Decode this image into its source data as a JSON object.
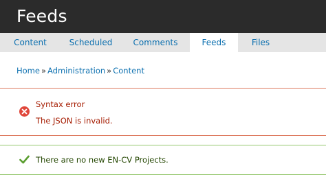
{
  "header": {
    "title": "Feeds"
  },
  "tabs": [
    {
      "label": "Content",
      "active": false
    },
    {
      "label": "Scheduled",
      "active": false
    },
    {
      "label": "Comments",
      "active": false
    },
    {
      "label": "Feeds",
      "active": true
    },
    {
      "label": "Files",
      "active": false
    }
  ],
  "breadcrumb": {
    "items": [
      "Home",
      "Administration",
      "Content"
    ],
    "separator": "»"
  },
  "messages": {
    "error": {
      "title": "Syntax error",
      "text": "The JSON is invalid.",
      "icon": "error-x-circle-icon",
      "color": "#a51b00",
      "border_color": "#dd7a5f"
    },
    "status": {
      "text": "There are no new EN-CV Projects.",
      "icon": "checkmark-icon",
      "color": "#234600",
      "border_color": "#93c66b"
    }
  },
  "colors": {
    "header_bg": "#2b2b2b",
    "tabbar_bg": "#e5e5e5",
    "link": "#0b6faf",
    "error_icon": "#e0473b",
    "status_icon": "#5a9e2f"
  }
}
